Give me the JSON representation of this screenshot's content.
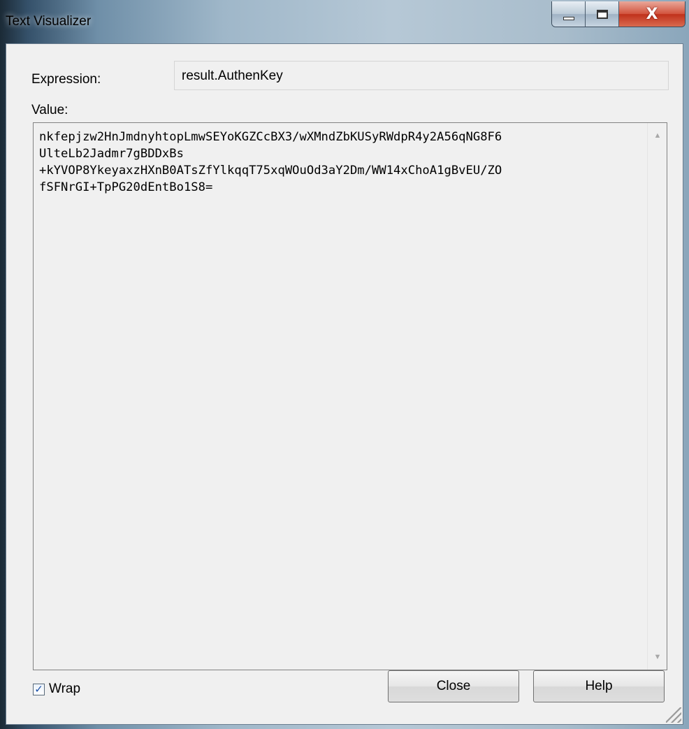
{
  "window": {
    "title": "Text Visualizer",
    "controls": {
      "minimize_icon": "minimize-icon",
      "maximize_icon": "maximize-icon",
      "close_glyph": "X"
    }
  },
  "expression": {
    "label": "Expression:",
    "value": "result.AuthenKey"
  },
  "value_section": {
    "label": "Value:",
    "text": "nkfepjzw2HnJmdnyhtopLmwSEYoKGZCcBX3/wXMndZbKUSyRWdpR4y2A56qNG8F6\nUlteLb2Jadmr7gBDDxBs\n+kYVOP8YkeyaxzHXnB0ATsZfYlkqqT75xqWOuOd3aY2Dm/WW14xChoA1gBvEU/ZO\nfSFNrGI+TpPG20dEntBo1S8="
  },
  "wrap": {
    "label": "Wrap",
    "checked": true
  },
  "buttons": {
    "close": "Close",
    "help": "Help"
  },
  "colors": {
    "dialog_background": "#f0f0f0",
    "close_button_red": "#c0311b",
    "checkbox_check": "#1a4fa8"
  }
}
